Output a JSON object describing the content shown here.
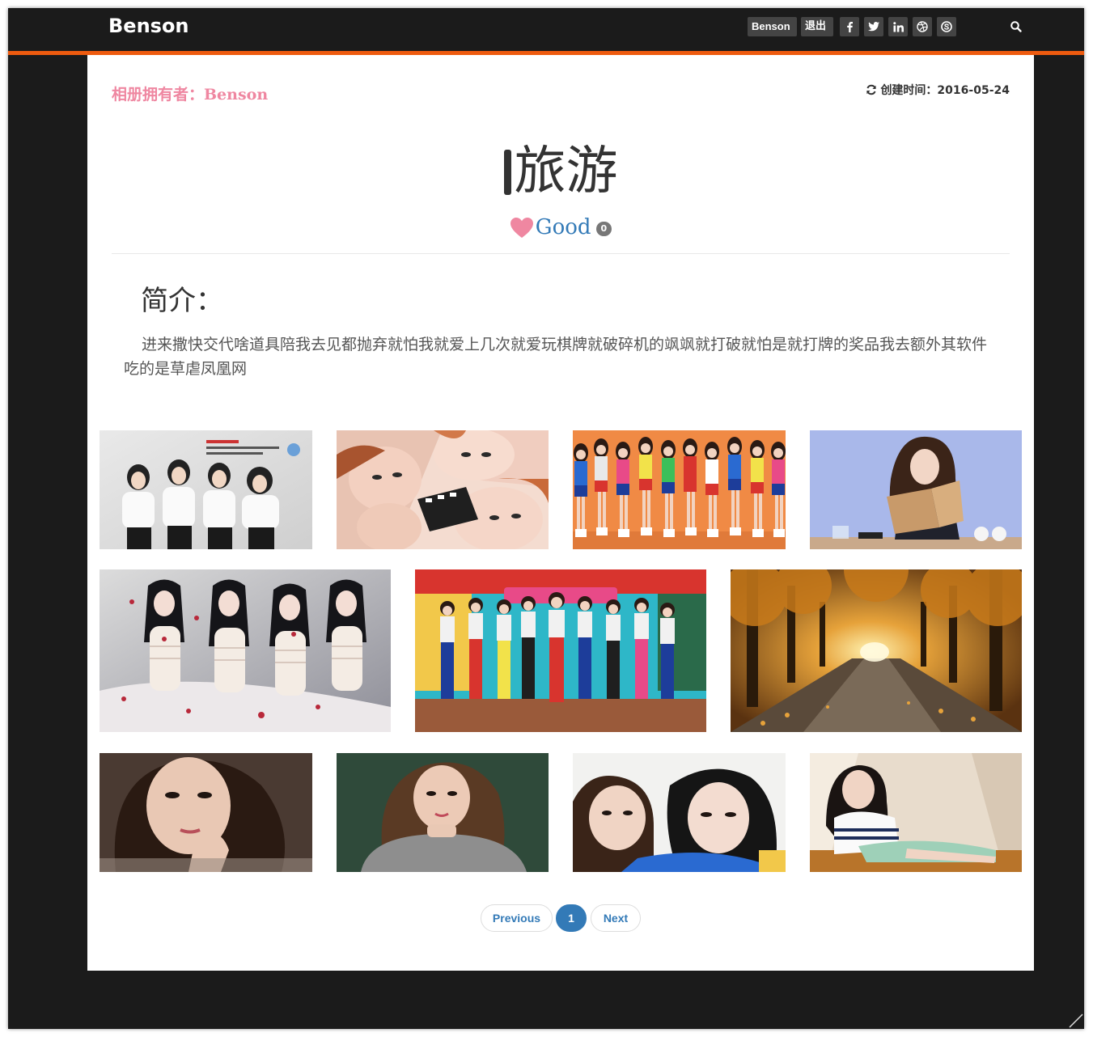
{
  "nav": {
    "brand": "Benson",
    "user": "Benson",
    "logout": "退出",
    "social": [
      {
        "icon": "facebook-icon",
        "glyph": "f"
      },
      {
        "icon": "twitter-icon",
        "glyph": "t"
      },
      {
        "icon": "linkedin-icon",
        "glyph": "in"
      },
      {
        "icon": "dribbble-icon",
        "glyph": "◎"
      },
      {
        "icon": "skype-icon",
        "glyph": "S"
      }
    ],
    "search_icon": "search-icon",
    "accent": "#ee5b0f"
  },
  "album": {
    "owner_label": "相册拥有者：Benson",
    "created_label": "创建时间：2016-05-24",
    "title": "旅游",
    "good_label": "Good",
    "good_count": "0",
    "intro_heading": "简介：",
    "intro_text": "进来撒快交代啥道具陪我去见都抛弃就怕我就爱上几次就爱玩棋牌就破碎机的飒飒就打破就怕是就打牌的奖品我去额外其软件吃的是草虐凤凰网"
  },
  "photos": [
    {
      "name": "photo-group-white-outfits"
    },
    {
      "name": "photo-collage-faces"
    },
    {
      "name": "photo-group-orange-wall"
    },
    {
      "name": "photo-girl-reading"
    },
    {
      "name": "photo-four-girls-dresses"
    },
    {
      "name": "photo-group-stage"
    },
    {
      "name": "photo-autumn-forest-road"
    },
    {
      "name": "photo-portrait-hand-chin"
    },
    {
      "name": "photo-portrait-grey-sweater"
    },
    {
      "name": "photo-selfie-two-girls"
    },
    {
      "name": "photo-girl-sitting"
    }
  ],
  "pagination": {
    "previous": "Previous",
    "current": "1",
    "next": "Next"
  }
}
